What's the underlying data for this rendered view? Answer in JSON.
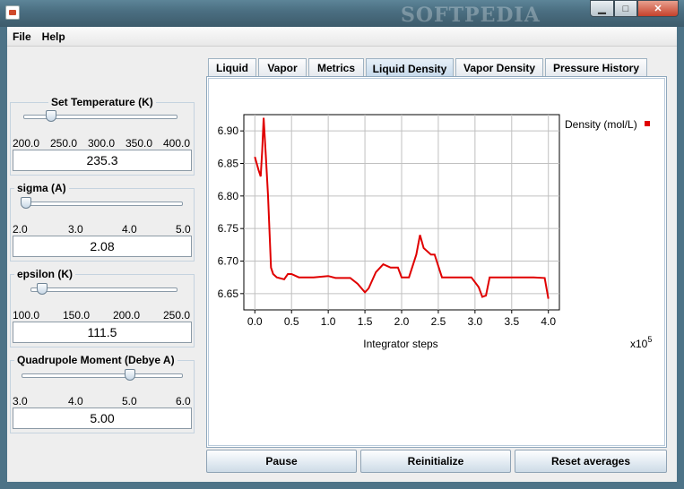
{
  "window": {
    "watermark": "SOFTPEDIA",
    "minimize_glyph": "▁",
    "maximize_glyph": "□",
    "close_glyph": "✕"
  },
  "menu": {
    "file": "File",
    "help": "Help"
  },
  "controls": [
    {
      "title": "Set Temperature (K)",
      "ticks": [
        "200.0",
        "250.0",
        "300.0",
        "350.0",
        "400.0"
      ],
      "value": "235.3",
      "slider_fraction": 0.18
    },
    {
      "title": "sigma (A)",
      "ticks": [
        "2.0",
        "3.0",
        "4.0",
        "5.0"
      ],
      "value": "2.08",
      "slider_fraction": 0.03
    },
    {
      "title": "epsilon (K)",
      "ticks": [
        "100.0",
        "150.0",
        "200.0",
        "250.0"
      ],
      "value": "111.5",
      "slider_fraction": 0.08
    },
    {
      "title": "Quadrupole Moment (Debye A)",
      "ticks": [
        "3.0",
        "4.0",
        "5.0",
        "6.0"
      ],
      "value": "5.00",
      "slider_fraction": 0.67
    }
  ],
  "tabs": [
    "Liquid",
    "Vapor",
    "Metrics",
    "Liquid Density",
    "Vapor Density",
    "Pressure History"
  ],
  "active_tab": "Liquid Density",
  "buttons": {
    "pause": "Pause",
    "reinitialize": "Reinitialize",
    "reset": "Reset averages"
  },
  "chart_data": {
    "type": "line",
    "xlabel": "Integrator steps",
    "x_multiplier": "x10",
    "x_multiplier_exp": "5",
    "xlim": [
      -0.15,
      4.15
    ],
    "ylim": [
      6.625,
      6.925
    ],
    "x_ticks": [
      0.0,
      0.5,
      1.0,
      1.5,
      2.0,
      2.5,
      3.0,
      3.5,
      4.0
    ],
    "x_tick_labels": [
      "0.0",
      "0.5",
      "1.0",
      "1.5",
      "2.0",
      "2.5",
      "3.0",
      "3.5",
      "4.0"
    ],
    "y_ticks": [
      6.65,
      6.7,
      6.75,
      6.8,
      6.85,
      6.9
    ],
    "y_tick_labels": [
      "6.65",
      "6.70",
      "6.75",
      "6.80",
      "6.85",
      "6.90"
    ],
    "grid": true,
    "legend_position": "top-right",
    "series": [
      {
        "name": "Density (mol/L)",
        "color": "#e00000",
        "x": [
          0.0,
          0.05,
          0.08,
          0.1,
          0.12,
          0.15,
          0.18,
          0.22,
          0.25,
          0.3,
          0.4,
          0.45,
          0.5,
          0.6,
          0.8,
          1.0,
          1.1,
          1.3,
          1.4,
          1.5,
          1.55,
          1.65,
          1.75,
          1.85,
          1.95,
          2.0,
          2.1,
          2.2,
          2.25,
          2.3,
          2.4,
          2.45,
          2.55,
          2.75,
          2.95,
          3.05,
          3.1,
          3.15,
          3.2,
          3.4,
          3.6,
          3.8,
          3.95,
          4.0
        ],
        "y": [
          6.86,
          6.84,
          6.83,
          6.87,
          6.92,
          6.86,
          6.8,
          6.69,
          6.68,
          6.675,
          6.672,
          6.68,
          6.68,
          6.675,
          6.675,
          6.677,
          6.674,
          6.674,
          6.665,
          6.652,
          6.658,
          6.683,
          6.695,
          6.69,
          6.69,
          6.675,
          6.675,
          6.71,
          6.74,
          6.72,
          6.71,
          6.71,
          6.675,
          6.675,
          6.675,
          6.66,
          6.645,
          6.647,
          6.675,
          6.675,
          6.675,
          6.675,
          6.674,
          6.642
        ]
      }
    ]
  }
}
